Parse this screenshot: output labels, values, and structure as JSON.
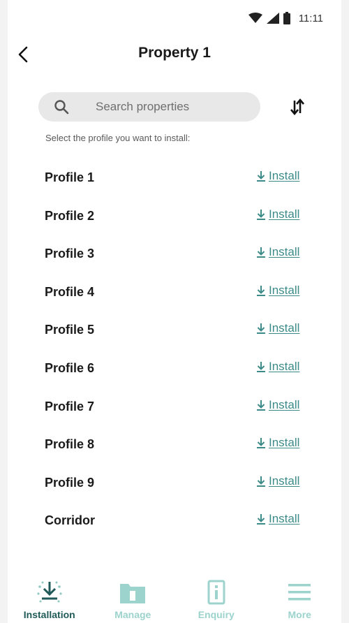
{
  "status_bar": {
    "time": "11:11"
  },
  "header": {
    "title": "Property 1"
  },
  "search": {
    "placeholder": "Search properties"
  },
  "instruction": "Select the profile you want to install:",
  "profiles": [
    {
      "name": "Profile 1",
      "action": "Install"
    },
    {
      "name": "Profile 2",
      "action": "Install"
    },
    {
      "name": "Profile 3",
      "action": "Install"
    },
    {
      "name": "Profile 4",
      "action": "Install"
    },
    {
      "name": "Profile 5",
      "action": "Install"
    },
    {
      "name": "Profile 6",
      "action": "Install"
    },
    {
      "name": "Profile 7",
      "action": "Install"
    },
    {
      "name": "Profile 8",
      "action": "Install"
    },
    {
      "name": "Profile 9",
      "action": "Install"
    },
    {
      "name": "Corridor",
      "action": "Install"
    }
  ],
  "nav": [
    {
      "label": "Installation",
      "icon": "download-icon",
      "active": true
    },
    {
      "label": "Manage",
      "icon": "folder-icon",
      "active": false
    },
    {
      "label": "Enquiry",
      "icon": "info-icon",
      "active": false
    },
    {
      "label": "More",
      "icon": "menu-icon",
      "active": false
    }
  ],
  "colors": {
    "accent": "#3c8b88",
    "nav_active": "#1f5a58",
    "nav_inactive": "#9cd3cc",
    "search_bg": "#e8e8e8"
  }
}
